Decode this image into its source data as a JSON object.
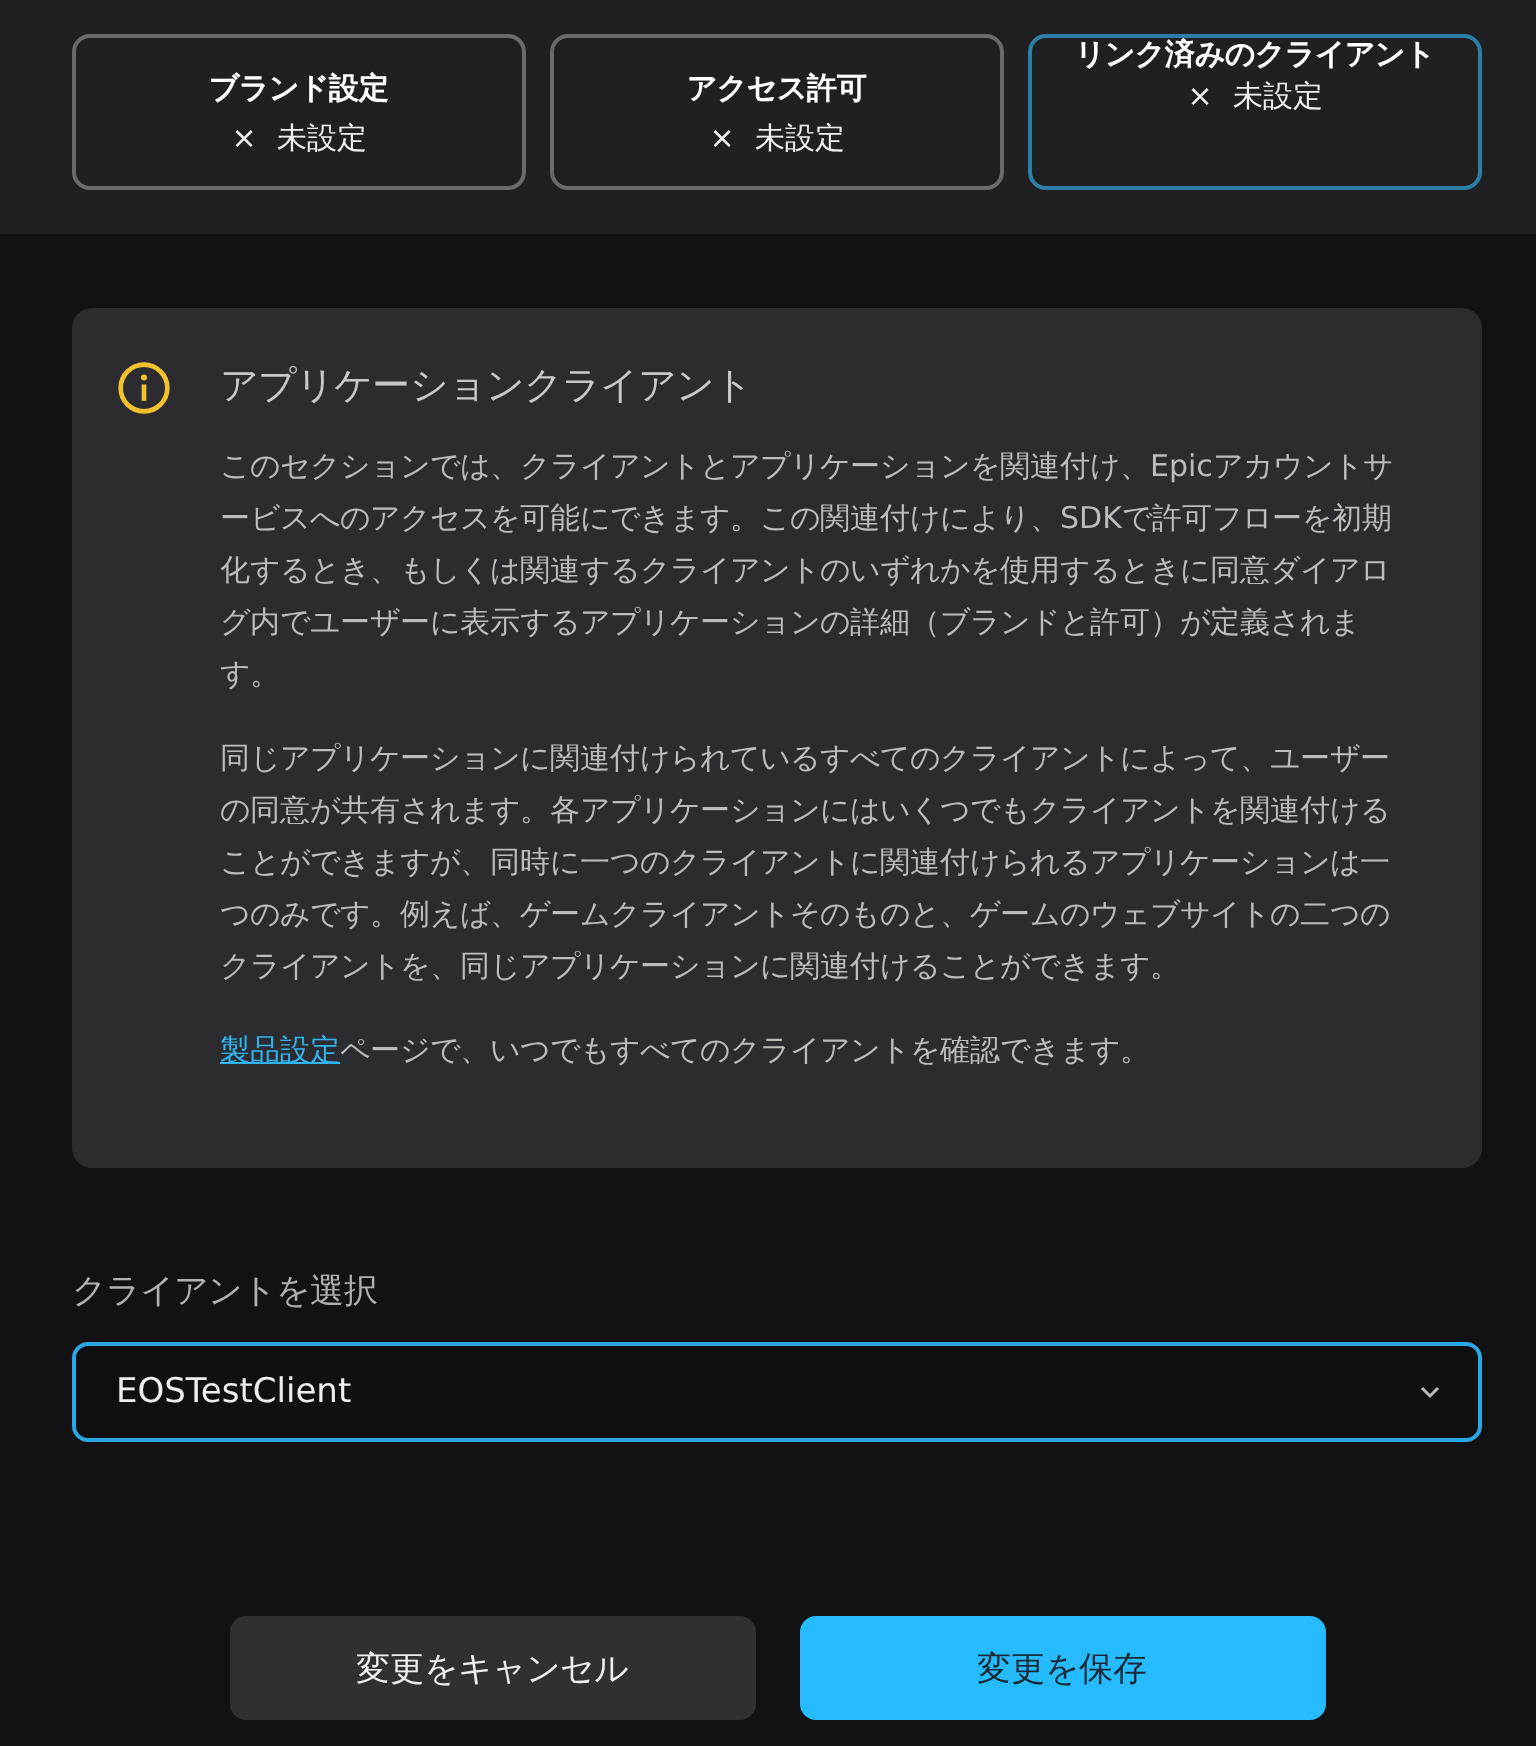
{
  "steps": [
    {
      "title": "ブランド設定",
      "status_icon": "×",
      "status": "未設定",
      "selected": false
    },
    {
      "title": "アクセス許可",
      "status_icon": "×",
      "status": "未設定",
      "selected": false
    },
    {
      "title": "リンク済みのクライアント",
      "status_icon": "×",
      "status": "未設定",
      "selected": true
    }
  ],
  "info": {
    "title": "アプリケーションクライアント",
    "paragraphs": [
      {
        "text": "このセクションでは、クライアントとアプリケーションを関連付け、Epicアカウントサービスへのアクセスを可能にできます。この関連付けにより、SDKで許可フローを初期化するとき、もしくは関連するクライアントのいずれかを使用するときに同意ダイアログ内でユーザーに表示するアプリケーションの詳細（ブランドと許可）が定義されます。"
      },
      {
        "text": "同じアプリケーションに関連付けられているすべてのクライアントによって、ユーザーの同意が共有されます。各アプリケーションにはいくつでもクライアントを関連付けることができますが、同時に一つのクライアントに関連付けられるアプリケーションは一つのみです。例えば、ゲームクライアントそのものと、ゲームのウェブサイトの二つのクライアントを、同じアプリケーションに関連付けることができます。"
      },
      {
        "link": "製品設定",
        "text": "ページで、いつでもすべてのクライアントを確認できます。"
      }
    ]
  },
  "client_select": {
    "label": "クライアントを選択",
    "value": "EOSTestClient"
  },
  "buttons": [
    {
      "label": "変更をキャンセル",
      "kind": "secondary"
    },
    {
      "label": "変更を保存",
      "kind": "primary"
    }
  ]
}
